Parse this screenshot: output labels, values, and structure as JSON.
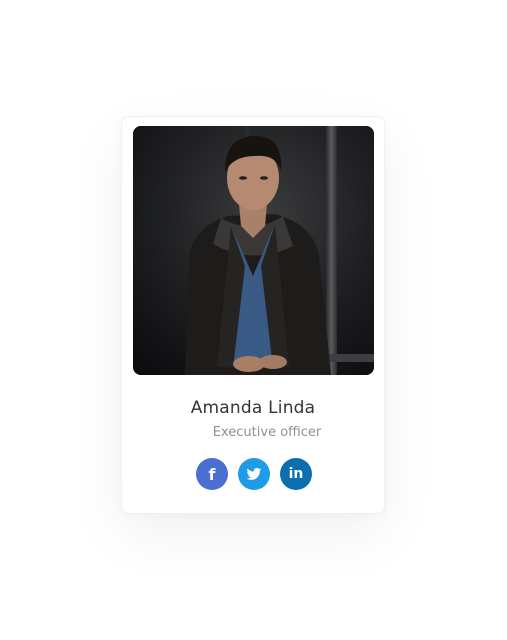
{
  "profile": {
    "name": "Amanda Linda",
    "role": "Executive officer",
    "photo_icon": "portrait-photo"
  },
  "social": [
    {
      "icon": "facebook-icon",
      "glyph": "f",
      "color": "#4a6fd1"
    },
    {
      "icon": "twitter-icon",
      "color": "#1f9be8"
    },
    {
      "icon": "linkedin-icon",
      "glyph": "in",
      "color": "#0c6fad"
    }
  ]
}
